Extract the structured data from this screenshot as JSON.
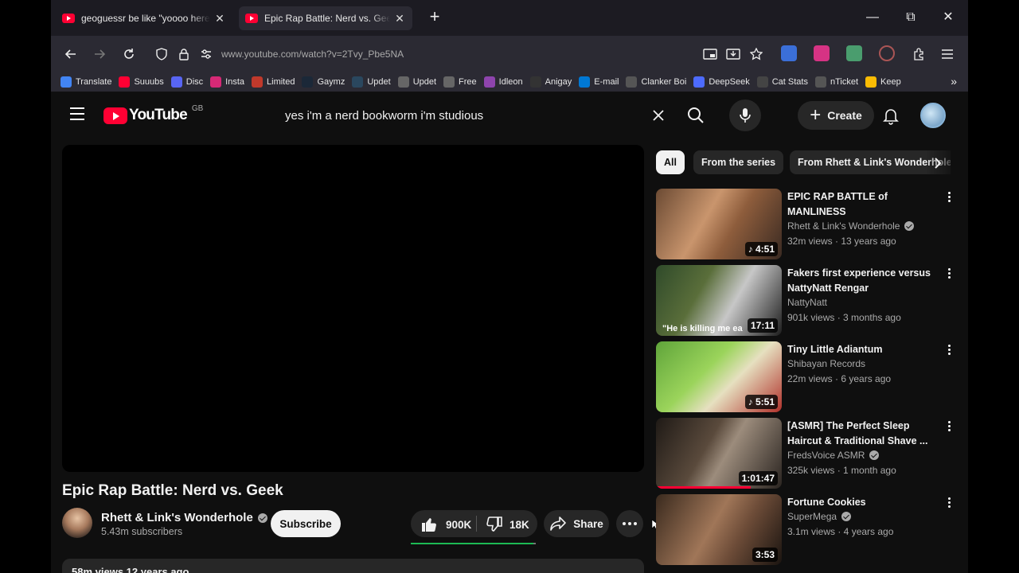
{
  "tabs": [
    {
      "title": "geoguessr be like \"yoooo here's the m",
      "active": false
    },
    {
      "title": "Epic Rap Battle: Nerd vs. Geek - YouTu",
      "active": true
    }
  ],
  "window": {
    "minimize": "—",
    "restore": "⧉",
    "close": "✕"
  },
  "toolbar": {
    "url": "www.youtube.com/watch?v=2Tvy_Pbe5NA"
  },
  "bookmarks": [
    {
      "label": "Translate",
      "color": "#4285f4"
    },
    {
      "label": "Suuubs",
      "color": "#ff0033"
    },
    {
      "label": "Disc",
      "color": "#5865f2"
    },
    {
      "label": "Insta",
      "color": "#d62976"
    },
    {
      "label": "Limited",
      "color": "#c0392b"
    },
    {
      "label": "Gaymz",
      "color": "#1b2838"
    },
    {
      "label": "Updet",
      "color": "#2a475e"
    },
    {
      "label": "Updet",
      "color": "#666666"
    },
    {
      "label": "Free",
      "color": "#666666"
    },
    {
      "label": "Idleon",
      "color": "#8e44ad"
    },
    {
      "label": "Anigay",
      "color": "#333333"
    },
    {
      "label": "E-mail",
      "color": "#0078d4"
    },
    {
      "label": "Clanker Boi",
      "color": "#555555"
    },
    {
      "label": "DeepSeek",
      "color": "#4d6bfe"
    },
    {
      "label": "Cat Stats",
      "color": "#444444"
    },
    {
      "label": "nTicket",
      "color": "#555555"
    },
    {
      "label": "Keep",
      "color": "#fbbc04"
    }
  ],
  "youtube": {
    "logo_text": "YouTube",
    "country_code": "GB",
    "search_query": "yes i'm a nerd bookworm i'm studious",
    "create_label": "Create"
  },
  "video": {
    "title": "Epic Rap Battle: Nerd vs. Geek",
    "channel": "Rhett & Link's Wonderhole",
    "subscribers": "5.43m subscribers",
    "subscribe_label": "Subscribe",
    "likes": "900K",
    "dislikes": "18K",
    "like_ratio": 0.98,
    "share_label": "Share",
    "description_peek": "58m views  12 years ago"
  },
  "chips": [
    "All",
    "From the series",
    "From Rhett & Link's Wonderhole"
  ],
  "recommendations": [
    {
      "title": "EPIC RAP BATTLE of MANLINESS",
      "channel": "Rhett & Link's Wonderhole",
      "verified": true,
      "meta": "32m views · 13 years ago",
      "duration": "4:51",
      "music": true,
      "watched": 0
    },
    {
      "title": "Fakers first experience versus NattyNatt Rengar",
      "channel": "NattyNatt",
      "verified": false,
      "meta": "901k views · 3 months ago",
      "duration": "17:11",
      "music": false,
      "watched": 0,
      "caption": "\"He is killing me ea"
    },
    {
      "title": "Tiny Little Adiantum",
      "channel": "Shibayan Records",
      "verified": false,
      "meta": "22m views · 6 years ago",
      "duration": "5:51",
      "music": true,
      "watched": 0
    },
    {
      "title": "[ASMR] The Perfect Sleep Haircut & Traditional Shave ...",
      "channel": "FredsVoice ASMR",
      "verified": true,
      "meta": "325k views · 1 month ago",
      "duration": "1:01:47",
      "music": false,
      "watched": 0.75
    },
    {
      "title": "Fortune Cookies",
      "channel": "SuperMega",
      "verified": true,
      "meta": "3.1m views · 4 years ago",
      "duration": "3:53",
      "music": false,
      "watched": 0
    }
  ]
}
